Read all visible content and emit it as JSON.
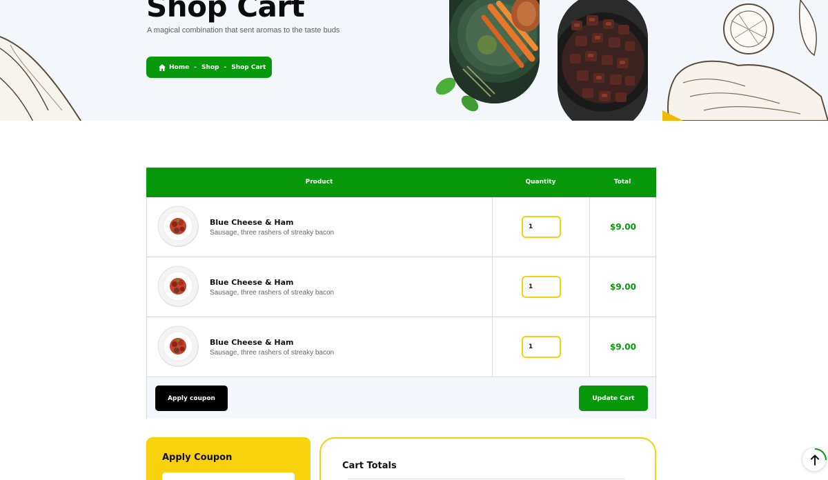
{
  "hero": {
    "title": "Shop Cart",
    "subtitle": "A magical combination that sent aromas to the taste buds",
    "breadcrumb": {
      "home": "Home",
      "separator": "-",
      "shop": "Shop",
      "current": "Shop Cart"
    }
  },
  "cart": {
    "headers": {
      "product": "Product",
      "quantity": "Quantity",
      "total": "Total"
    },
    "items": [
      {
        "name": "Blue Cheese & Ham",
        "description": "Sausage, three rashers of streaky bacon",
        "quantity": "1",
        "total": "$9.00"
      },
      {
        "name": "Blue Cheese & Ham",
        "description": "Sausage, three rashers of streaky bacon",
        "quantity": "1",
        "total": "$9.00"
      },
      {
        "name": "Blue Cheese & Ham",
        "description": "Sausage, three rashers of streaky bacon",
        "quantity": "1",
        "total": "$9.00"
      }
    ],
    "apply_coupon_label": "Apply coupon",
    "update_cart_label": "Update Cart"
  },
  "coupon_panel": {
    "title": "Apply Coupon"
  },
  "totals_panel": {
    "title": "Cart Totals"
  },
  "colors": {
    "primary_green": "#07990b",
    "accent_yellow": "#f9d20e",
    "hero_bg": "#f3f7fc"
  },
  "icons": {
    "breadcrumb_home": "home-icon",
    "scroll_top": "arrow-up-icon"
  }
}
